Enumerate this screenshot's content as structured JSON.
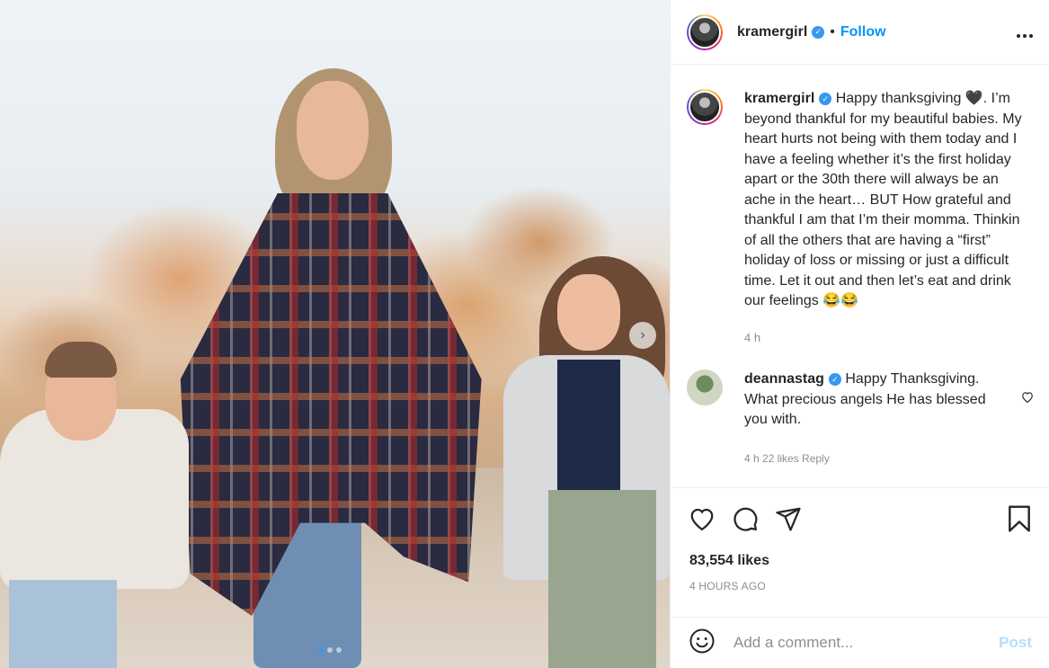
{
  "post": {
    "username": "kramergirl",
    "follow_label": "Follow",
    "separator": "•",
    "more_label": "•••"
  },
  "caption": {
    "username": "kramergirl",
    "text": "Happy thanksgiving 🖤. I’m beyond thankful for my beautiful babies. My heart hurts not being with them today and I have a feeling whether it’s the first holiday apart or the 30th there will always be an ache in the heart… BUT How grateful and thankful I am that I’m their momma. Thinkin of all the others that are having a “first” holiday of loss or missing or just a difficult time. Let it out and then let’s eat and drink our feelings 😂😂",
    "time": "4 h"
  },
  "comment": {
    "username": "deannastag",
    "text": "Happy Thanksgiving. What precious angels He has blessed you with.",
    "meta": "4 h   22 likes   Reply"
  },
  "stats": {
    "likes": "83,554 likes",
    "posted": "4 HOURS AGO"
  },
  "add_comment": {
    "placeholder": "Add a comment...",
    "post_label": "Post"
  },
  "carousel": {
    "slides": 3,
    "current": 1
  },
  "colors": {
    "accent": "#0095f6",
    "verified": "#3897f0",
    "muted": "#8e8e8e"
  },
  "icons": [
    "heart-icon",
    "comment-icon",
    "share-icon",
    "bookmark-icon",
    "emoji-icon",
    "chevron-right-icon",
    "verified-icon",
    "more-icon"
  ]
}
